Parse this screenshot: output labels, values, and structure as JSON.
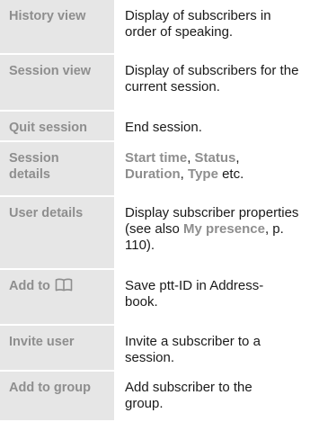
{
  "rows": [
    {
      "term": "History view",
      "description": "Display of subscribers in order of speaking."
    },
    {
      "term": "Session view",
      "description": "Display of subscribers for the current session."
    },
    {
      "term": "Quit session",
      "description": "End session."
    },
    {
      "term": "Session details",
      "description_parts": {
        "start_time": "Start time",
        "sep1": ", ",
        "status": "Status",
        "sep2": ",",
        "duration": "Duration",
        "sep3": ", ",
        "type": "Type",
        "tail": " etc."
      }
    },
    {
      "term": "User details",
      "description_parts": {
        "text": "Display subscriber properties (see also ",
        "link": "My presence",
        "tail": ", p. 110)."
      }
    },
    {
      "term": "Add to",
      "term_icon": "address-book-icon",
      "description": "Save ptt-ID in Address-book."
    },
    {
      "term": "Invite user",
      "description": "Invite a subscriber to a session."
    },
    {
      "term": "Add to group",
      "description": "Add subscriber to the group."
    }
  ]
}
